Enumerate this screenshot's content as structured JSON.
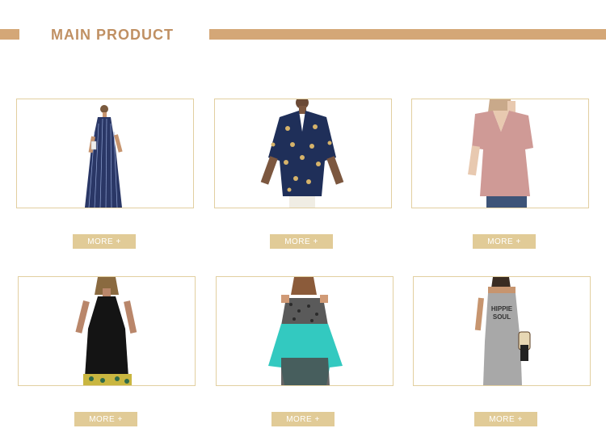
{
  "section": {
    "title": "MAIN PRODUCT",
    "accent_color": "#d4a777"
  },
  "products": [
    {
      "more_label": "MORE +",
      "image": "navy-striped-maxi-dress"
    },
    {
      "more_label": "MORE +",
      "image": "navy-print-button-shirt"
    },
    {
      "more_label": "MORE +",
      "image": "pink-v-neck-tee"
    },
    {
      "more_label": "MORE +",
      "image": "black-halter-dress"
    },
    {
      "more_label": "MORE +",
      "image": "turquoise-cold-shoulder-top"
    },
    {
      "more_label": "MORE +",
      "image": "grey-slogan-maxi-dress"
    }
  ],
  "colors": {
    "button_bg": "#e1cb97",
    "card_border": "#e2cfa0",
    "title": "#c09063"
  }
}
